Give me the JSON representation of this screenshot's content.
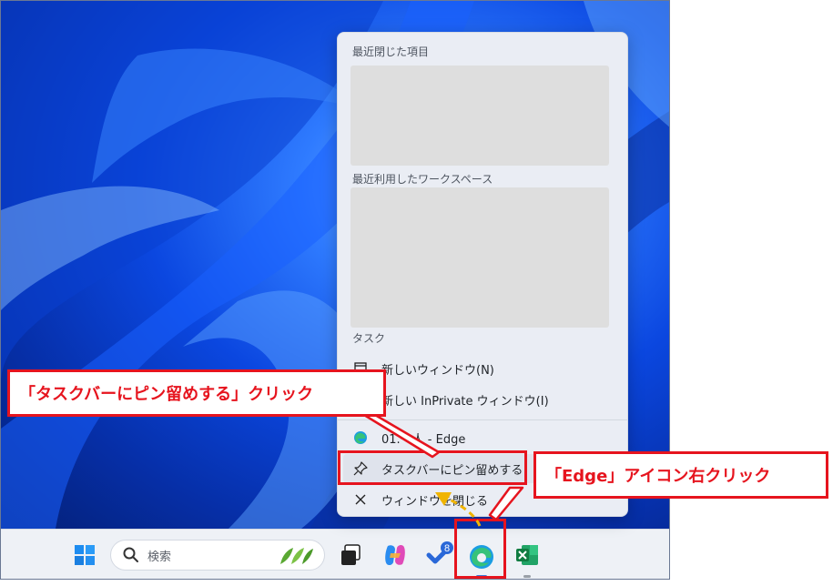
{
  "jumplist": {
    "recent_header": "最近閉じた項目",
    "workspaces_header": "最近利用したワークスペース",
    "tasks_header": "タスク",
    "new_window": "新しいウィンドウ(N)",
    "new_inprivate": "新しい InPrivate ウィンドウ(I)",
    "app_name": "01.一人 - Edge",
    "pin_to_taskbar": "タスクバーにピン留めする",
    "close_window": "ウィンドウを閉じる"
  },
  "taskbar": {
    "search_placeholder": "検索",
    "todo_badge": "8"
  },
  "annotations": {
    "pin_callout": "「タスクバーにピン留めする」クリック",
    "edge_callout": "「Edge」アイコン右クリック"
  },
  "colors": {
    "annotation_red": "#e6141e",
    "arrow_yellow": "#f0b400",
    "edge_accent": "#3a78d8"
  },
  "icons": [
    "windows-start-icon",
    "search-icon",
    "task-view-icon",
    "copilot-icon",
    "todo-icon",
    "edge-icon",
    "excel-icon",
    "window-icon",
    "inprivate-icon",
    "pin-icon",
    "close-icon"
  ]
}
